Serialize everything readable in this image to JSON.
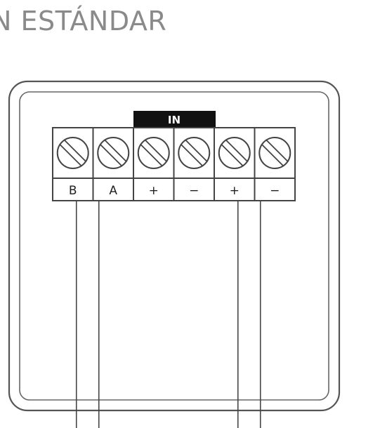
{
  "heading": "N ESTÁNDAR",
  "diagram": {
    "in_label": "IN",
    "terminals": [
      {
        "label": "B",
        "wired": true
      },
      {
        "label": "A",
        "wired": true
      },
      {
        "label": "+",
        "wired": false
      },
      {
        "label": "−",
        "wired": false
      },
      {
        "label": "+",
        "wired": true
      },
      {
        "label": "−",
        "wired": true
      }
    ],
    "colors": {
      "stroke": "#444444",
      "in_bar": "#111111",
      "heading": "#8a8a8a"
    }
  }
}
